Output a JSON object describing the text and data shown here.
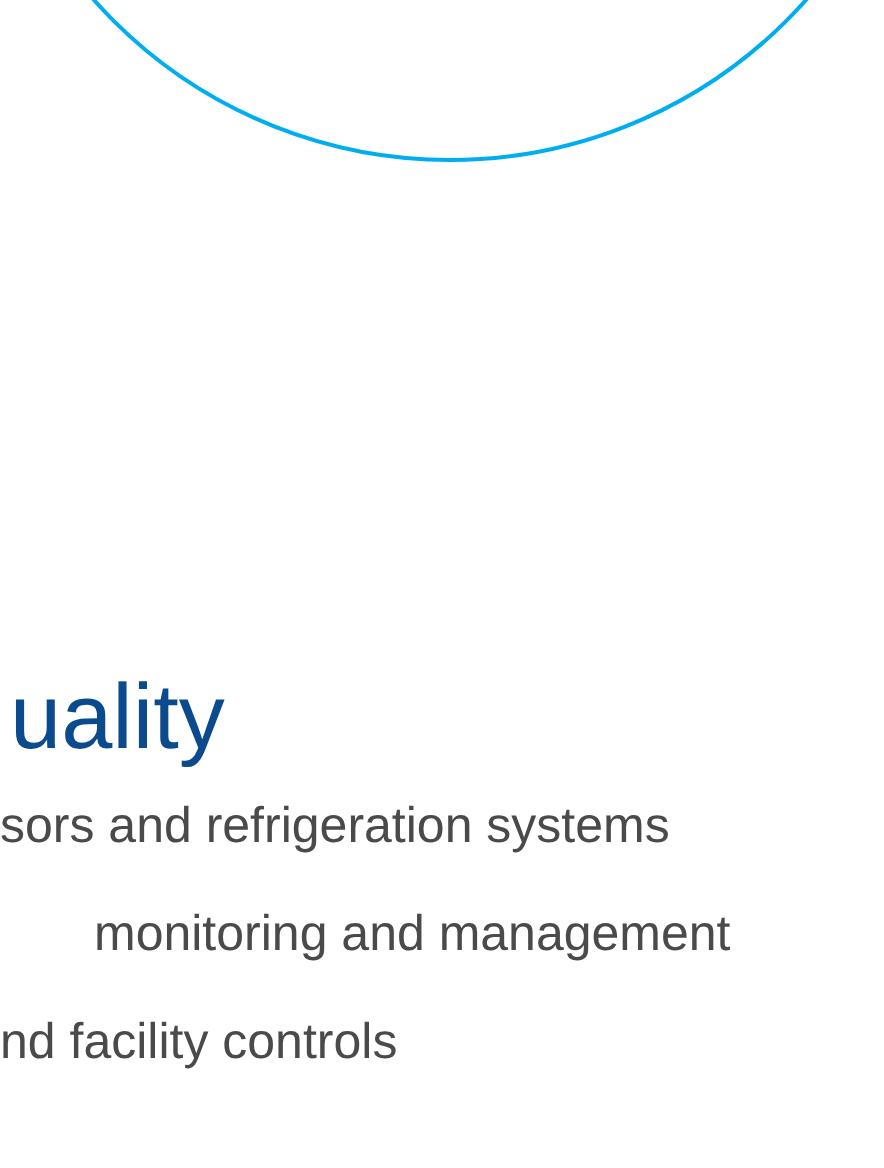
{
  "heading": "uality",
  "lines": [
    {
      "text": "sors and refrigeration systems",
      "indented": false
    },
    {
      "text": "monitoring and management",
      "indented": true
    },
    {
      "text": "nd facility controls",
      "indented": false
    }
  ]
}
